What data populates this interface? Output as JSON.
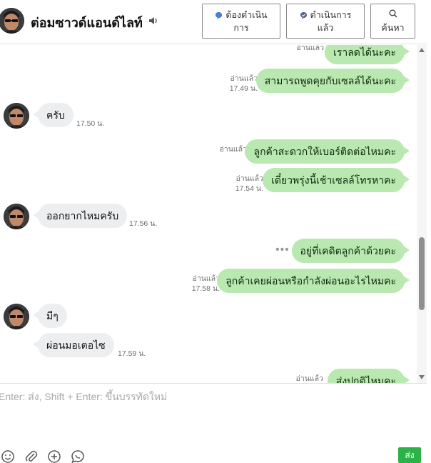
{
  "header": {
    "title": "ต่อมซาวด์แอนด์ไลท์",
    "buttons": {
      "todo_line1": "ต้องดำเนิน",
      "todo_line2": "การ",
      "done_line1": "ดำเนินการ",
      "done_line2": "แล้ว",
      "search": "ค้นหา"
    }
  },
  "messages": [
    {
      "side": "out",
      "text": "เราลดได้นะคะ",
      "read": "อ่านแล้ว",
      "time": ""
    },
    {
      "side": "out",
      "text": "สามารถพูดคุยกับเซลล์ได้นะคะ",
      "read": "อ่านแล้ว",
      "time": "17.49 น."
    },
    {
      "side": "in",
      "text": "ครับ",
      "time": "17.50 น."
    },
    {
      "side": "out",
      "text": "ลูกค้าสะดวกให้เบอร์ติดต่อไหมคะ",
      "read": "อ่านแล้ว",
      "time": ""
    },
    {
      "side": "out",
      "text": "เดี๋ยวพรุ่งนี้เช้าเซลล์โทรหาคะ",
      "read": "อ่านแล้ว",
      "time": "17.54 น."
    },
    {
      "side": "in",
      "text": "ออกยากไหมครับ",
      "time": "17.56 น."
    },
    {
      "side": "out",
      "text": "อยู่ที่เคดิตลูกค้าด้วยคะ",
      "read": "",
      "time": ""
    },
    {
      "side": "out",
      "text": "ลูกค้าเคยผ่อนหรือกำลังผ่อนอะไรไหมคะ",
      "read": "อ่านแล้ว",
      "time": "17.58 น."
    },
    {
      "side": "in",
      "text": "มีๆ",
      "time": ""
    },
    {
      "side": "in",
      "text": "ผ่อนมอเตอไซ",
      "time": "17.59 น."
    },
    {
      "side": "out",
      "text": "ส่งปกติไหมคะ",
      "read": "อ่านแล้ว",
      "time": ""
    }
  ],
  "composer": {
    "placeholder": "Enter: ส่ง, Shift + Enter: ขึ้นบรรทัดใหม่",
    "send_label": "ส่ง"
  },
  "colors": {
    "outgoing_bubble": "#b9e8b0",
    "incoming_bubble": "#eceef0",
    "send_button": "#2bb34a",
    "header_icon_blue": "#4a7fd6"
  }
}
